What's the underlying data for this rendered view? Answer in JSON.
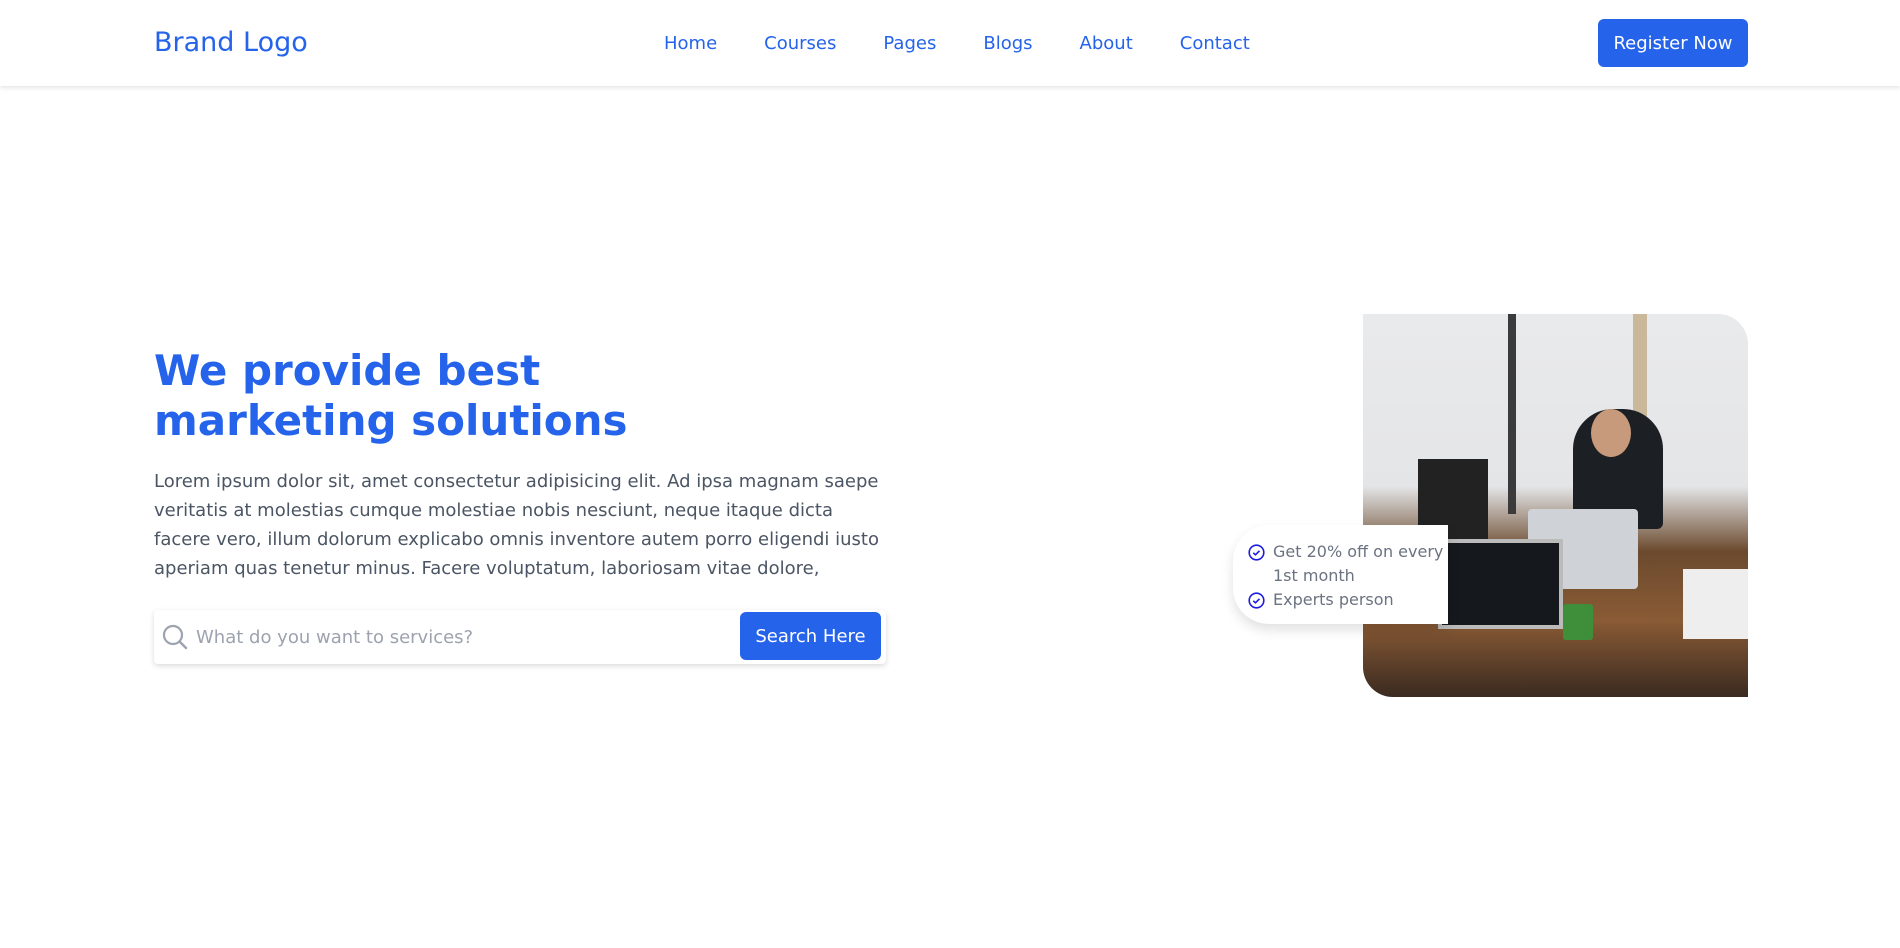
{
  "nav": {
    "brand": "Brand Logo",
    "links": [
      "Home",
      "Courses",
      "Pages",
      "Blogs",
      "About",
      "Contact"
    ],
    "register": "Register Now"
  },
  "hero": {
    "title": "We provide best marketing solutions",
    "description": "Lorem ipsum dolor sit, amet consectetur adipisicing elit. Ad ipsa magnam saepe veritatis at molestias cumque molestiae nobis nesciunt, neque itaque dicta facere vero, illum dolorum explicabo omnis inventore autem porro eligendi iusto aperiam quas tenetur minus. Facere voluptatum, laboriosam vitae dolore,",
    "search_placeholder": "What do you want to services?",
    "search_button": "Search Here"
  },
  "badge": {
    "items": [
      "Get 20% off on every 1st month",
      "Experts person"
    ]
  },
  "colors": {
    "accent": "#2563eb"
  },
  "icons": {
    "search": "search-icon",
    "check": "check-circle-icon"
  }
}
